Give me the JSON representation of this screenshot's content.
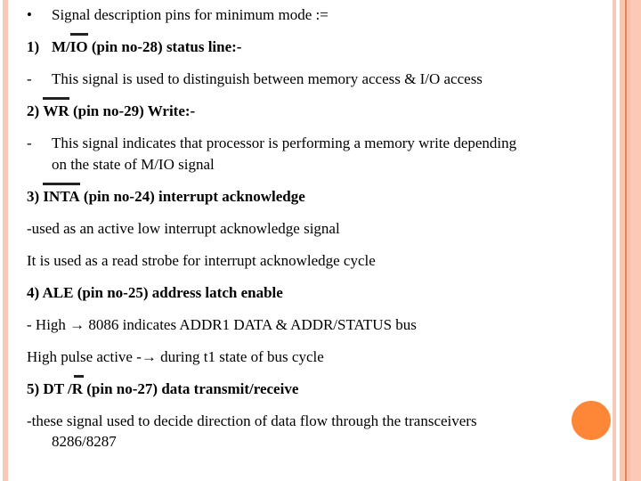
{
  "slide": {
    "intro": {
      "marker": "•",
      "text": "Signal description pins for minimum mode :="
    },
    "items": [
      {
        "number": "1)",
        "heading_pre": "",
        "signal_overlined": "IO",
        "signal_prefix": "M/",
        "heading_rest": " (pin no-28) status line:-",
        "desc_marker": "-",
        "desc": "This signal is used to distinguish between memory access & I/O access"
      },
      {
        "number": "2)",
        "signal_overlined": "WR",
        "heading_rest": " (pin  no-29) Write:-",
        "desc_marker": "-",
        "desc_line1": "This signal indicates that processor is performing a memory write depending",
        "desc_line2": "on the state of M/IO signal"
      },
      {
        "number": "3)",
        "signal_overlined": "INTA",
        "heading_rest": " (pin no-24) interrupt acknowledge",
        "desc_line1": "-used as an active low interrupt acknowledge signal",
        "desc_line2": "It is used as a read strobe for interrupt acknowledge cycle"
      },
      {
        "number": "4)",
        "heading": "ALE (pin no-25) address latch enable",
        "desc_line1_pre": "- High ",
        "arrow": "→",
        "desc_line1_post": " 8086 indicates ADDR1 DATA & ADDR/STATUS bus",
        "desc_line2_pre": "High pulse active -",
        "desc_line2_post": " during t1 state of bus cycle"
      },
      {
        "number": "5)",
        "signal_prefix": "DT /",
        "signal_overlined": "R",
        "heading_rest": " (pin  no-27) data transmit/receive",
        "desc_line1": "-these signal used to decide direction of data flow through the transceivers",
        "desc_line2": "8286/8287"
      }
    ]
  },
  "colors": {
    "accent_dot": "#fd8637",
    "border": "#f8c8b8",
    "border_line": "#e0875a"
  }
}
